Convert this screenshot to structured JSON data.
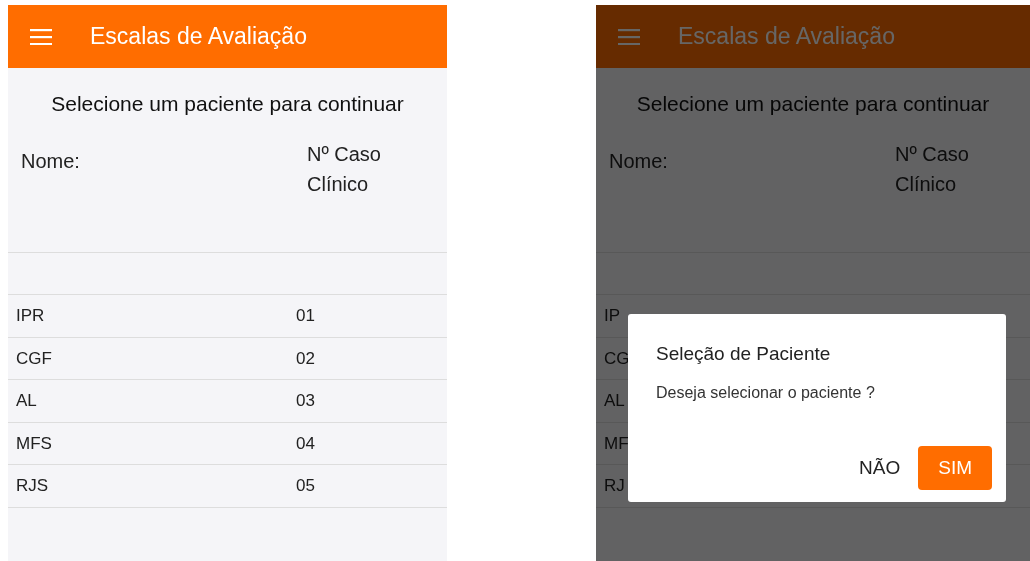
{
  "screens": [
    {
      "app_bar": {
        "title": "Escalas de Avaliação"
      },
      "prompt": "Selecione um paciente para continuar",
      "columns": [
        "Nome:",
        "Nº Caso Clínico"
      ],
      "dimmed": false,
      "rows": [
        {
          "name": "IPR",
          "case": "01"
        },
        {
          "name": "CGF",
          "case": "02"
        },
        {
          "name": "AL",
          "case": "03"
        },
        {
          "name": "MFS",
          "case": "04"
        },
        {
          "name": "RJS",
          "case": "05"
        }
      ]
    },
    {
      "app_bar": {
        "title": "Escalas de Avaliação"
      },
      "prompt": "Selecione um paciente para continuar",
      "columns": [
        "Nome:",
        "Nº Caso Clínico"
      ],
      "dimmed": true,
      "rows": [
        {
          "name": "IP"
        },
        {
          "name": "CG"
        },
        {
          "name": "AL"
        },
        {
          "name": "MF"
        },
        {
          "name": "RJ"
        }
      ],
      "dialog": {
        "title": "Seleção de Paciente",
        "message": "Deseja selecionar o paciente ?",
        "buttons": [
          {
            "label": "NÃO",
            "kind": "text"
          },
          {
            "label": "SIM",
            "kind": "primary"
          }
        ]
      }
    }
  ]
}
